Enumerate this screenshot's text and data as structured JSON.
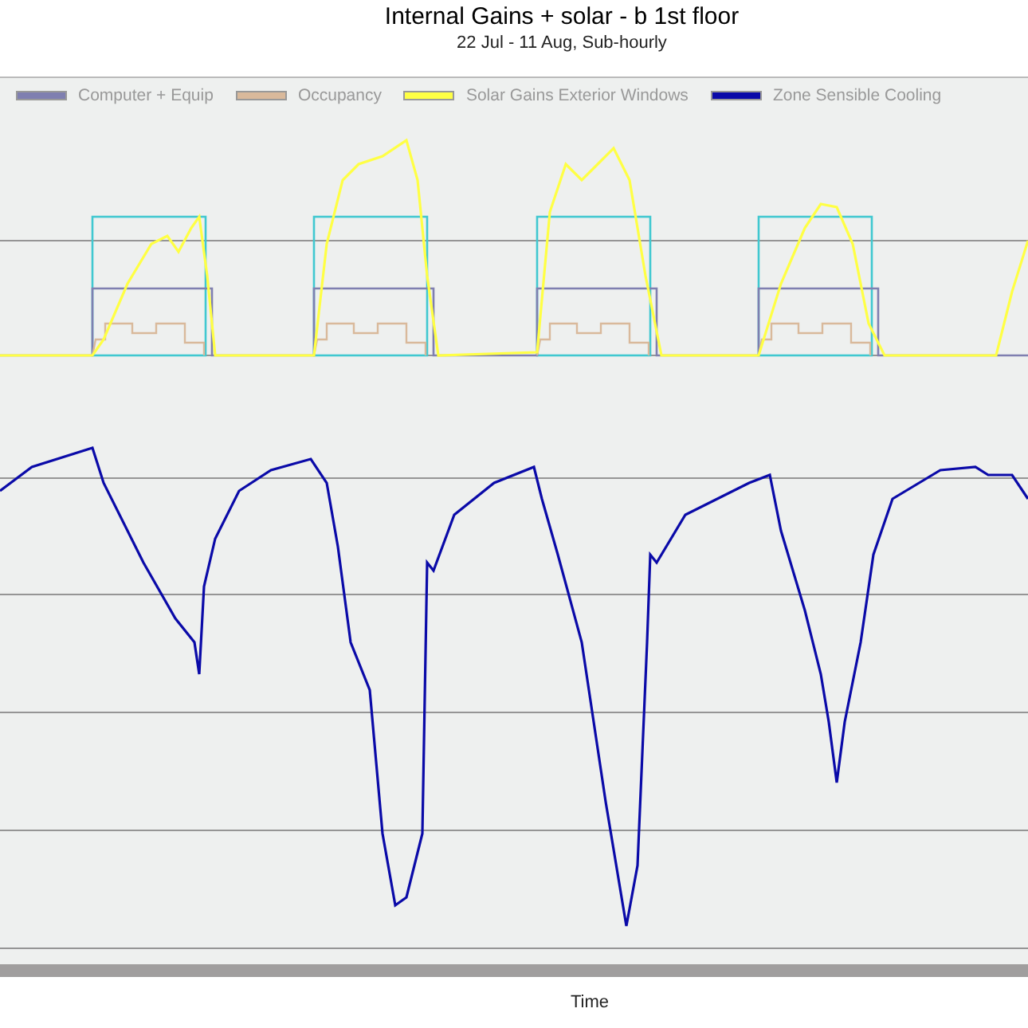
{
  "title": "Internal Gains + solar - b 1st floor",
  "subtitle": "22 Jul - 11 Aug, Sub-hourly",
  "legend": [
    {
      "label": "Computer + Equip",
      "color": "#7f7fb0"
    },
    {
      "label": "Occupancy",
      "color": "#d9b99b"
    },
    {
      "label": "Solar Gains Exterior Windows",
      "color": "#ffff44"
    },
    {
      "label": "Zone Sensible Cooling",
      "color": "#0a0aa8"
    }
  ],
  "xlabel": "Time"
}
